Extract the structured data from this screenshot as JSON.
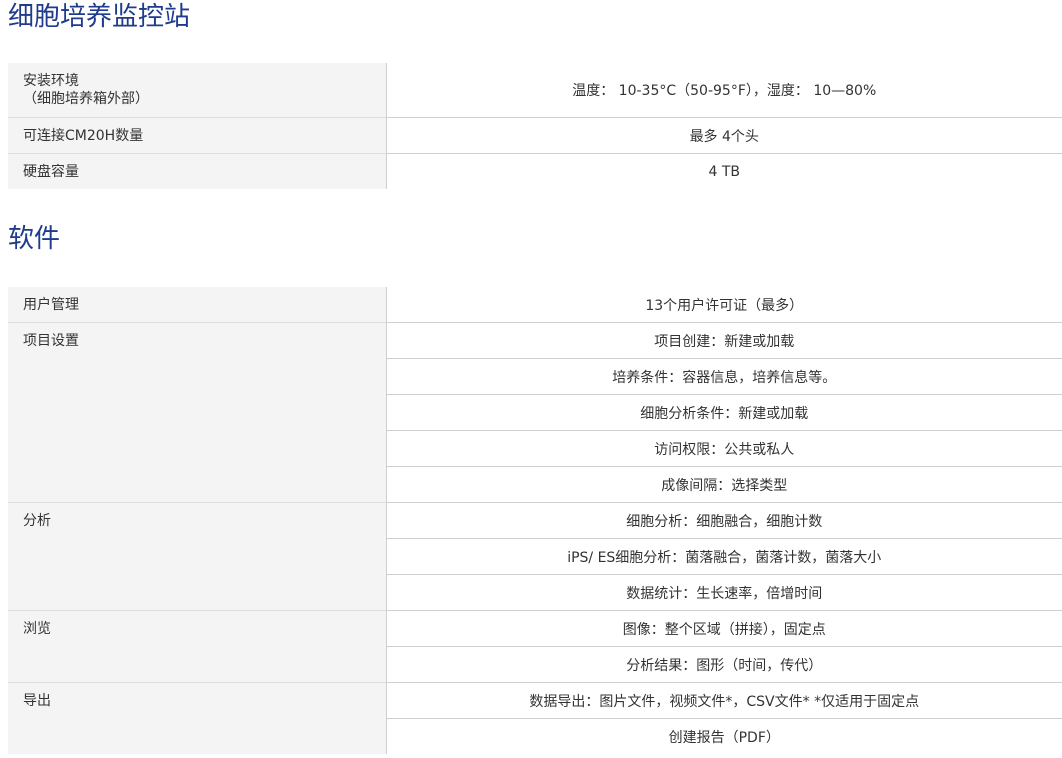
{
  "sections": {
    "station": {
      "title": "细胞培养监控站",
      "rows": [
        {
          "label_line1": "安装环境",
          "label_line2": "（细胞培养箱外部）",
          "value": "温度： 10-35°C（50-95°F），湿度： 10—80%"
        },
        {
          "label": "可连接CM20H数量",
          "value": "最多 4个头"
        },
        {
          "label": "硬盘容量",
          "value": "4 TB"
        }
      ]
    },
    "software": {
      "title": "软件",
      "groups": [
        {
          "label": "用户管理",
          "values": [
            "13个用户许可证（最多）"
          ]
        },
        {
          "label": "项目设置",
          "values": [
            "项目创建：新建或加载",
            "培养条件：容器信息，培养信息等。",
            "细胞分析条件：新建或加载",
            "访问权限：公共或私人",
            "成像间隔：选择类型"
          ]
        },
        {
          "label": "分析",
          "values": [
            "细胞分析：细胞融合，细胞计数",
            "iPS/ ES细胞分析：菌落融合，菌落计数，菌落大小",
            "数据统计：生长速率，倍增时间"
          ]
        },
        {
          "label": "浏览",
          "values": [
            "图像：整个区域（拼接），固定点",
            "分析结果：图形（时间，传代）"
          ]
        },
        {
          "label": "导出",
          "values": [
            "数据导出：图片文件，视频文件*，CSV文件* *仅适用于固定点",
            "创建报告（PDF）"
          ]
        }
      ]
    }
  }
}
